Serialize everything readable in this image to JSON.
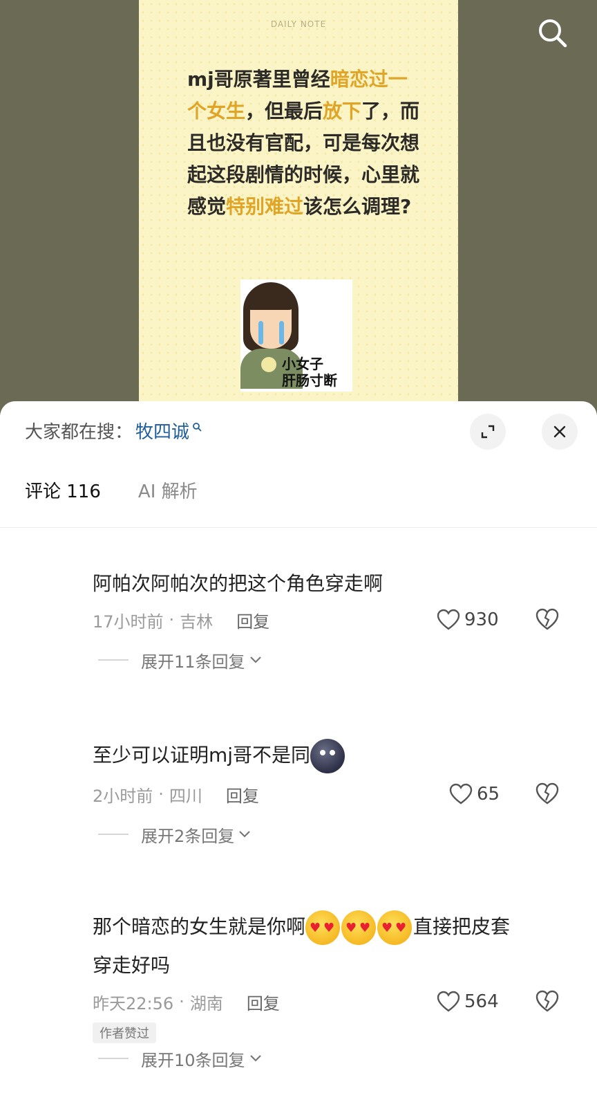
{
  "note": {
    "header": "DAILY NOTE",
    "segments": [
      {
        "t": "mj哥原著里曾经",
        "hl": false
      },
      {
        "t": "暗恋过一个女生",
        "hl": true
      },
      {
        "t": "，但最后",
        "hl": false
      },
      {
        "t": "放下",
        "hl": true
      },
      {
        "t": "了，而且也没有官配，可是每次想起这段剧情的时候，心里就感觉",
        "hl": false
      },
      {
        "t": "特别难过",
        "hl": true
      },
      {
        "t": "该怎么调理?",
        "hl": false
      }
    ],
    "sticker_caption_line1": "小女子",
    "sticker_caption_line2": "肝肠寸断",
    "highlight_color": "#e0a526"
  },
  "panel": {
    "search_prefix": "大家都在搜：",
    "search_keyword": "牧四诚",
    "tabs": [
      {
        "label": "评论 116"
      },
      {
        "label": "AI 解析"
      }
    ]
  },
  "comments": [
    {
      "text": "阿帕次阿帕次的把这个角色穿走啊",
      "time": "17小时前",
      "location": "吉林",
      "reply": "回复",
      "likes": "930",
      "expand": "展开11条回复"
    },
    {
      "text": "至少可以证明mj哥不是同",
      "emoji": "new-moon-face",
      "time": "2小时前",
      "location": "四川",
      "reply": "回复",
      "likes": "65",
      "expand": "展开2条回复"
    },
    {
      "text_a": "那个暗恋的女生就是你啊",
      "emoji": "face-blowing-kiss x3",
      "text_b": "直接把皮套",
      "text_c": "穿走好吗",
      "time": "昨天22:56",
      "location": "湖南",
      "reply": "回复",
      "likes": "564",
      "badge": "作者赞过",
      "expand": "展开10条回复"
    }
  ],
  "dot_sep": "·"
}
